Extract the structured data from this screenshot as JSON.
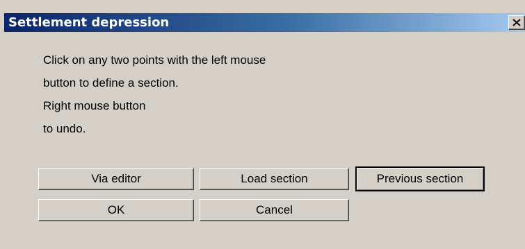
{
  "window": {
    "title": "Settlement depression",
    "close_icon": "close-icon"
  },
  "instructions": {
    "lines": [
      "Click on any two points with the left mouse",
      "button to define a section.",
      "Right mouse button",
      "to undo."
    ]
  },
  "buttons": {
    "via_editor": "Via editor",
    "load_section": "Load section",
    "previous_section": "Previous section",
    "ok": "OK",
    "cancel": "Cancel"
  }
}
